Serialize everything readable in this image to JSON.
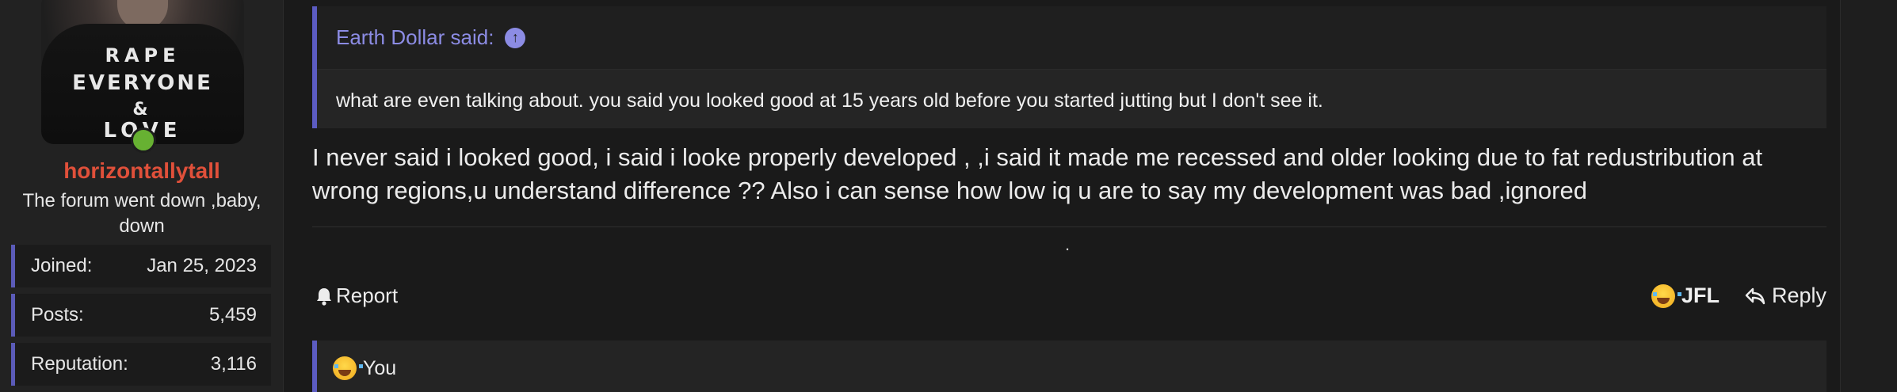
{
  "user": {
    "username": "horizontallytall",
    "title": "The forum went down ,baby, down",
    "avatar_text": [
      "RAPE",
      "EVERYONE",
      "&",
      "LOVE"
    ],
    "online_color": "#67b132",
    "stats": [
      {
        "label": "Joined:",
        "value": "Jan 25, 2023"
      },
      {
        "label": "Posts:",
        "value": "5,459"
      },
      {
        "label": "Reputation:",
        "value": "3,116"
      }
    ]
  },
  "post": {
    "quote": {
      "author": "Earth Dollar said:",
      "icon": "arrow-up-circle-icon",
      "text": "what are even talking about. you said you looked good at 15 years old before you started jutting but I don't see it."
    },
    "message": "I never said i looked good, i said i looke properly developed , ,i said it made me recessed and older looking due to fat redustribution at wrong regions,u understand difference ?? Also i can sense how low iq u are to say my development was bad ,ignored",
    "separator": ".",
    "actions": {
      "report": "Report",
      "reaction": "JFL",
      "reply": "Reply"
    },
    "reactions_bar": {
      "text": "You"
    }
  },
  "colors": {
    "accent": "#5c5cc2",
    "username": "#e0503a",
    "quote_author": "#8c8ce4"
  }
}
